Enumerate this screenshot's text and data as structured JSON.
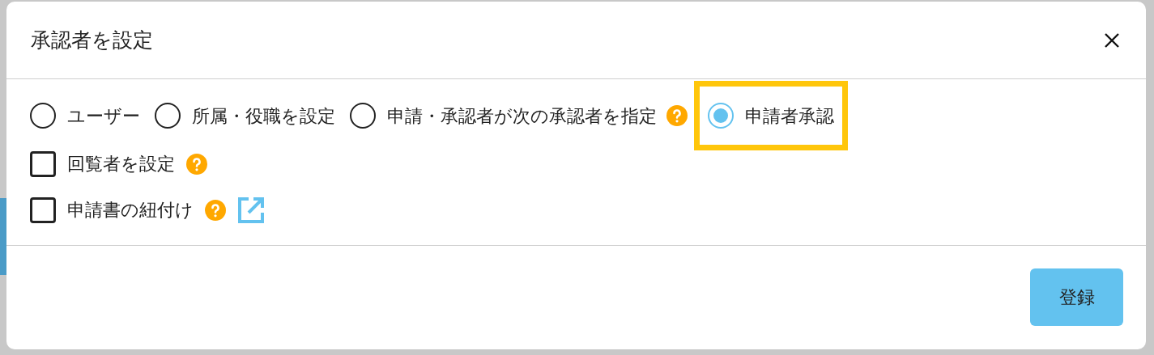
{
  "dialog": {
    "title": "承認者を設定"
  },
  "approver_types": [
    {
      "label": "ユーザー",
      "selected": false,
      "help": false,
      "highlighted": false
    },
    {
      "label": "所属・役職を設定",
      "selected": false,
      "help": false,
      "highlighted": false
    },
    {
      "label": "申請・承認者が次の承認者を指定",
      "selected": false,
      "help": true,
      "highlighted": false
    },
    {
      "label": "申請者承認",
      "selected": true,
      "help": false,
      "highlighted": true
    }
  ],
  "options": [
    {
      "label": "回覧者を設定",
      "checked": false,
      "help": true,
      "link": false
    },
    {
      "label": "申請書の紐付け",
      "checked": false,
      "help": true,
      "link": true
    }
  ],
  "buttons": [
    {
      "label": "登録"
    }
  ]
}
